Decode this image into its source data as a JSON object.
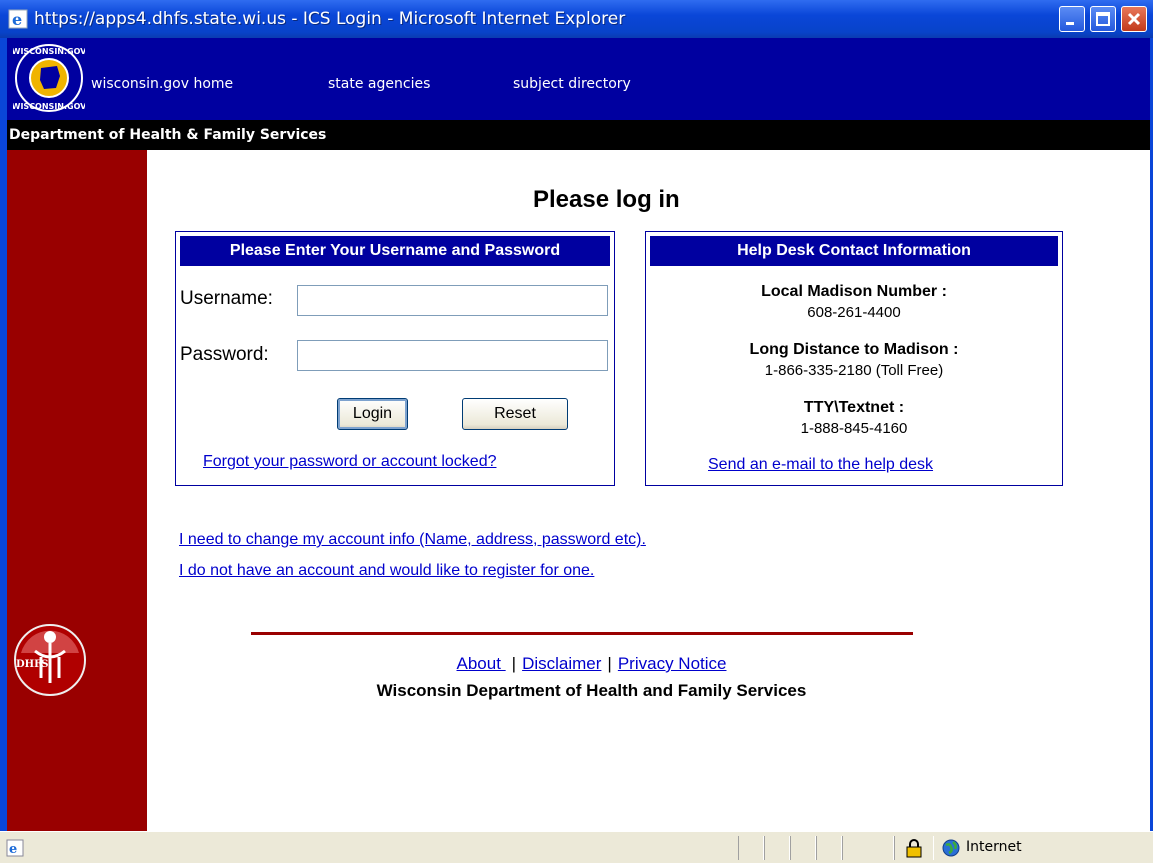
{
  "window": {
    "title": "https://apps4.dhfs.state.wi.us - ICS Login - Microsoft Internet Explorer"
  },
  "nav": {
    "home": "wisconsin.gov home",
    "agencies": "state agencies",
    "directory": "subject directory"
  },
  "dept_bar": "Department of Health & Family Services",
  "heading": "Please log in",
  "login_box": {
    "title": "Please Enter Your Username and Password",
    "username_label": "Username:",
    "username_value": "",
    "password_label": "Password:",
    "password_value": "",
    "login_button": "Login",
    "reset_button": "Reset",
    "forgot_link": "Forgot your password or account locked?"
  },
  "help_box": {
    "title": "Help Desk Contact Information",
    "local_label": "Local Madison Number :",
    "local_number": "608-261-4400",
    "long_label": "Long Distance to Madison :",
    "long_number": "1-866-335-2180 (Toll Free)",
    "tty_label": "TTY\\Textnet :",
    "tty_number": "1-888-845-4160",
    "email_link": "Send an e-mail to the help desk"
  },
  "links": {
    "change_account": "I need to change my account info (Name, address, password etc).",
    "register": "I do not have an account and would like to register for one."
  },
  "footer": {
    "about": "About ",
    "sep": "|",
    "disclaimer": "Disclaimer",
    "privacy": "Privacy Notice",
    "org": "Wisconsin Department of Health and Family Services"
  },
  "logos": {
    "seal_text_top": "WISCONSIN.GOV",
    "seal_text_bottom": "WISCONSIN.GOV",
    "dhfs": "DHFS"
  },
  "statusbar": {
    "zone": "Internet"
  },
  "colors": {
    "nav_blue": "#0000a0",
    "left_red": "#990000",
    "link": "#0000cc"
  }
}
